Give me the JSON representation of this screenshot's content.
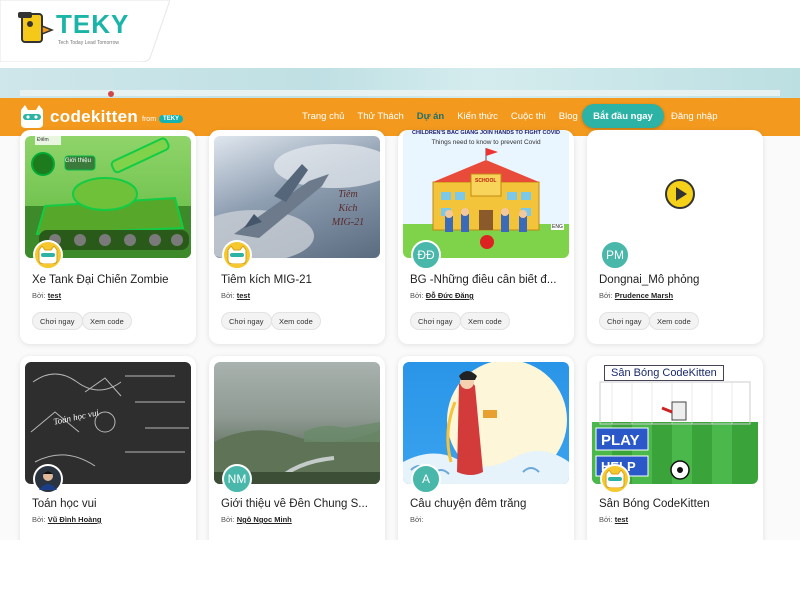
{
  "teky": {
    "brand": "TEKY",
    "tagline": "Tech Today Lead Tomorrow"
  },
  "nav": {
    "brand": "codekitten",
    "from": "from",
    "teky_badge": "TEKY",
    "links": [
      "Trang chủ",
      "Thử Thách",
      "Dự án",
      "Kiến thức",
      "Cuộc thi",
      "Blog"
    ],
    "active_index": 2,
    "cta": "Bắt đầu ngay",
    "login": "Đăng nhập"
  },
  "common": {
    "author_prefix": "Bởi:",
    "play": "Chơi ngay",
    "view_code": "Xem code"
  },
  "projects": [
    {
      "title": "Xe Tank Đại Chiến Zombie",
      "author": "test",
      "avatar": "cat",
      "thumb_label_1": "Giới thiệu",
      "thumb_label_2": "Điểm"
    },
    {
      "title": "Tiêm kích MIG-21",
      "author": "test",
      "avatar": "cat",
      "thumb_text": "Tiêm Kích MIG-21"
    },
    {
      "title": "BG -Những điều cần biết đ...",
      "author": "Đỗ Đức Đăng",
      "avatar": "ĐĐ",
      "thumb_heading": "CHILDREN'S BAC GIANG JOIN HANDS TO FIGHT COVID",
      "thumb_sub": "Things need to know to prevent Covid",
      "school_sign": "SCHOOL",
      "lang_badge": "ENG"
    },
    {
      "title": "Dongnai_Mô phỏng",
      "author": "Prudence Marsh",
      "avatar": "PM"
    },
    {
      "title": "Toán học vui",
      "author": "Vũ Đình Hoàng",
      "avatar": "photo",
      "thumb_text": "Toán học vui"
    },
    {
      "title": "Giới thiệu về Đền Chung S...",
      "author": "Ngô Ngọc Minh",
      "avatar": "NM"
    },
    {
      "title": "Câu chuyện đêm trăng",
      "author": "",
      "avatar": "A"
    },
    {
      "title": "Sân Bóng CodeKitten",
      "author": "test",
      "avatar": "cat",
      "thumb_title": "Sân Bóng CodeKitten",
      "play_label": "PLAY",
      "help_label": "HELP"
    }
  ],
  "colors": {
    "orange": "#f39a1e",
    "teal": "#2db3a6",
    "active_link": "#1f6f6c"
  }
}
